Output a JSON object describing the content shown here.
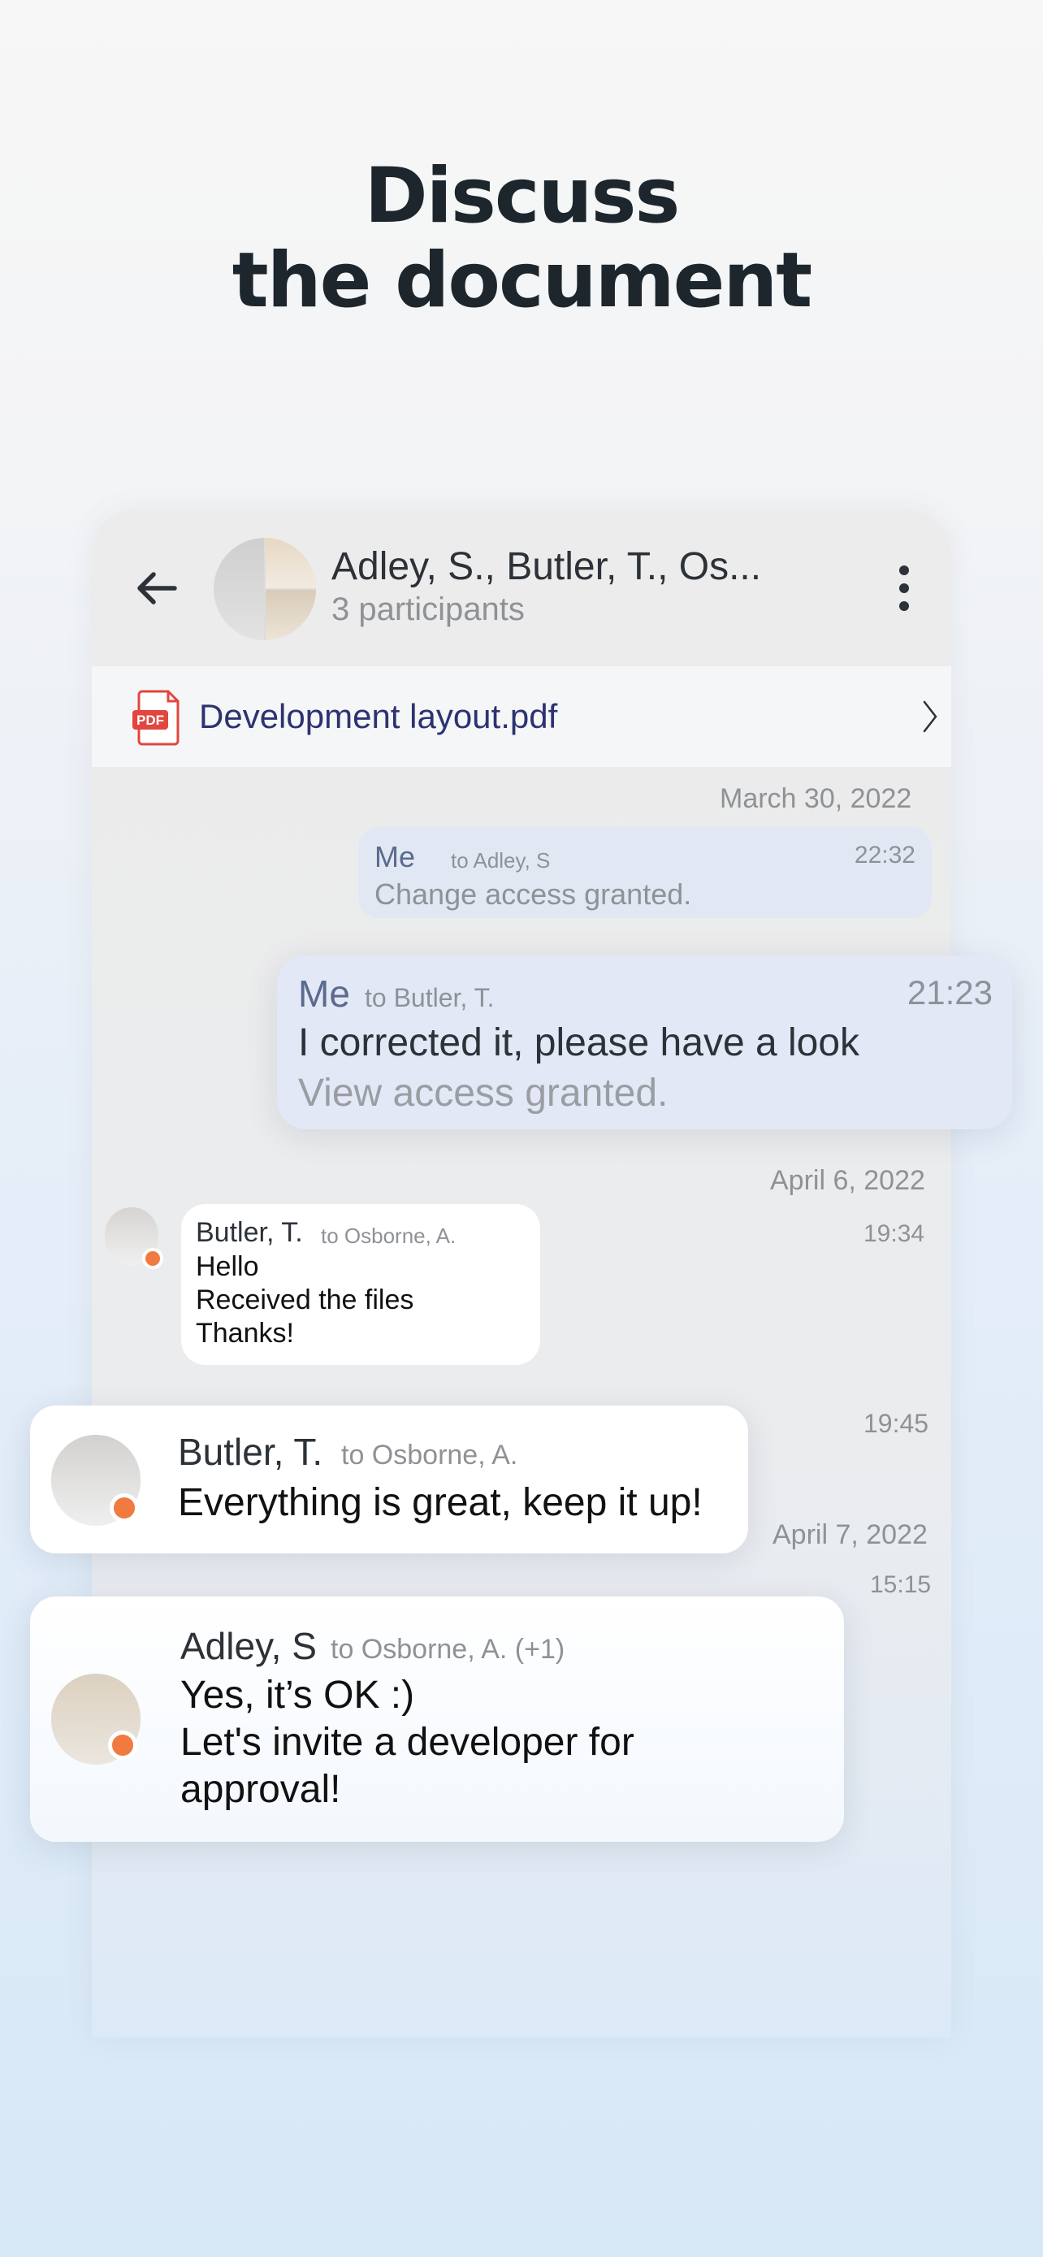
{
  "headline": {
    "line1": "Discuss",
    "line2": "the document"
  },
  "chat": {
    "title": "Adley, S., Butler, T., Os...",
    "participants": "3 participants"
  },
  "file": {
    "icon_label": "PDF",
    "name": "Development layout.pdf"
  },
  "dates": {
    "d1": "March 30, 2022",
    "d2": "April 6, 2022",
    "d3": "April 7, 2022"
  },
  "messages": {
    "m1": {
      "sender": "Me",
      "recipient": "to Adley, S",
      "time": "22:32",
      "text": "Change access granted."
    },
    "m2": {
      "sender": "Me",
      "recipient": "to Butler, T.",
      "time": "21:23",
      "text": "I corrected it, please have a look",
      "status": "View access granted."
    },
    "m3": {
      "sender": "Butler, T.",
      "recipient": "to Osborne, A.",
      "time": "19:34",
      "lines": [
        "Hello",
        "Received the files",
        "Thanks!"
      ]
    },
    "m4": {
      "sender": "Butler, T.",
      "recipient": "to Osborne, A.",
      "time": "19:45",
      "text": "Everything is great, keep it up!"
    },
    "m5": {
      "sender": "Adley, S",
      "recipient": "to Osborne, A. (+1)",
      "time": "15:15",
      "lines": [
        "Yes, it’s OK :)",
        "Let's invite a developer for",
        "approval!"
      ]
    }
  },
  "colors": {
    "accent_dot": "#f07a3f",
    "my_bubble": "#e2e7f4",
    "file_name": "#2d3270",
    "pdf_red": "#e2463f"
  }
}
